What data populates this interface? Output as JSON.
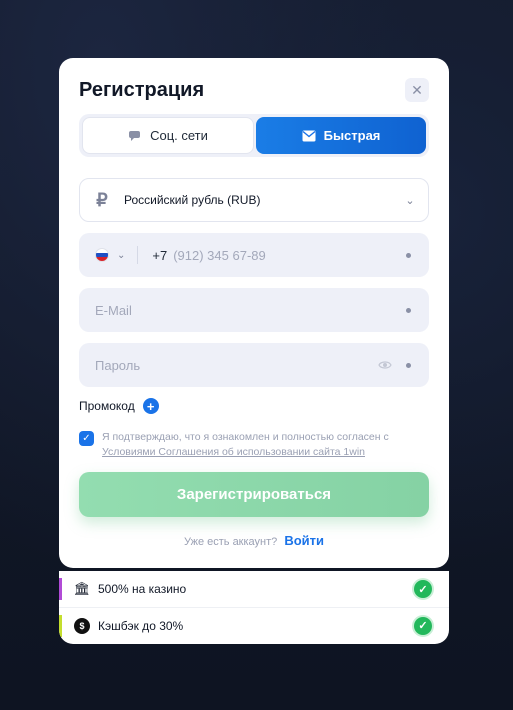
{
  "modal": {
    "title": "Регистрация",
    "close_icon": "✕"
  },
  "tabs": [
    {
      "label": "Соц. сети",
      "icon": "chat-bubble-icon",
      "active": false
    },
    {
      "label": "Быстрая",
      "icon": "envelope-icon",
      "active": true
    }
  ],
  "currency": {
    "symbol": "₽",
    "label": "Российский рубль (RUB)"
  },
  "phone": {
    "country": "RU",
    "code": "+7",
    "placeholder": "(912) 345 67-89"
  },
  "email": {
    "placeholder": "E-Mail"
  },
  "password": {
    "placeholder": "Пароль"
  },
  "promo": {
    "label": "Промокод",
    "plus": "+"
  },
  "consent": {
    "checked": true,
    "text": "Я подтверждаю, что я ознакомлен и полностью согласен с",
    "link": "Условиями Соглашения об использовании сайта 1win"
  },
  "register_button": "Зарегистрироваться",
  "login": {
    "prompt": "Уже есть аккаунт?",
    "link": "Войти"
  },
  "bonuses": [
    {
      "label": "500% на казино",
      "icon": "bank-icon",
      "accent": "#b14bd6"
    },
    {
      "label": "Кэшбэк до 30%",
      "icon": "cashback-coin-icon",
      "accent": "#c4de2e"
    }
  ],
  "colors": {
    "primary": "#1a73e8",
    "register_green": "#8ed8aa",
    "check_green": "#22b85b"
  }
}
